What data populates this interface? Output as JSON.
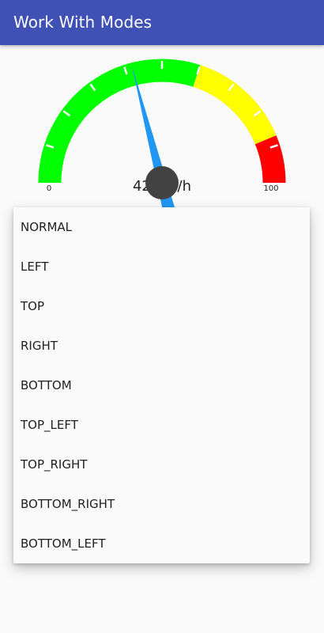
{
  "app_bar": {
    "title": "Work With Modes"
  },
  "gauge": {
    "speed": 42,
    "speed_text": "42 km/h",
    "min_label": "0",
    "max_label": "100",
    "min_speed": 0,
    "max_speed": 100,
    "colors": {
      "low": "#00ff00",
      "medium": "#ffff00",
      "high": "#ff0000",
      "indicator": "#2196f3",
      "center": "#424242"
    }
  },
  "dropdown": {
    "items": [
      {
        "label": "NORMAL"
      },
      {
        "label": "LEFT"
      },
      {
        "label": "TOP"
      },
      {
        "label": "RIGHT"
      },
      {
        "label": "BOTTOM"
      },
      {
        "label": "TOP_LEFT"
      },
      {
        "label": "TOP_RIGHT"
      },
      {
        "label": "BOTTOM_RIGHT"
      },
      {
        "label": "BOTTOM_LEFT"
      }
    ]
  }
}
